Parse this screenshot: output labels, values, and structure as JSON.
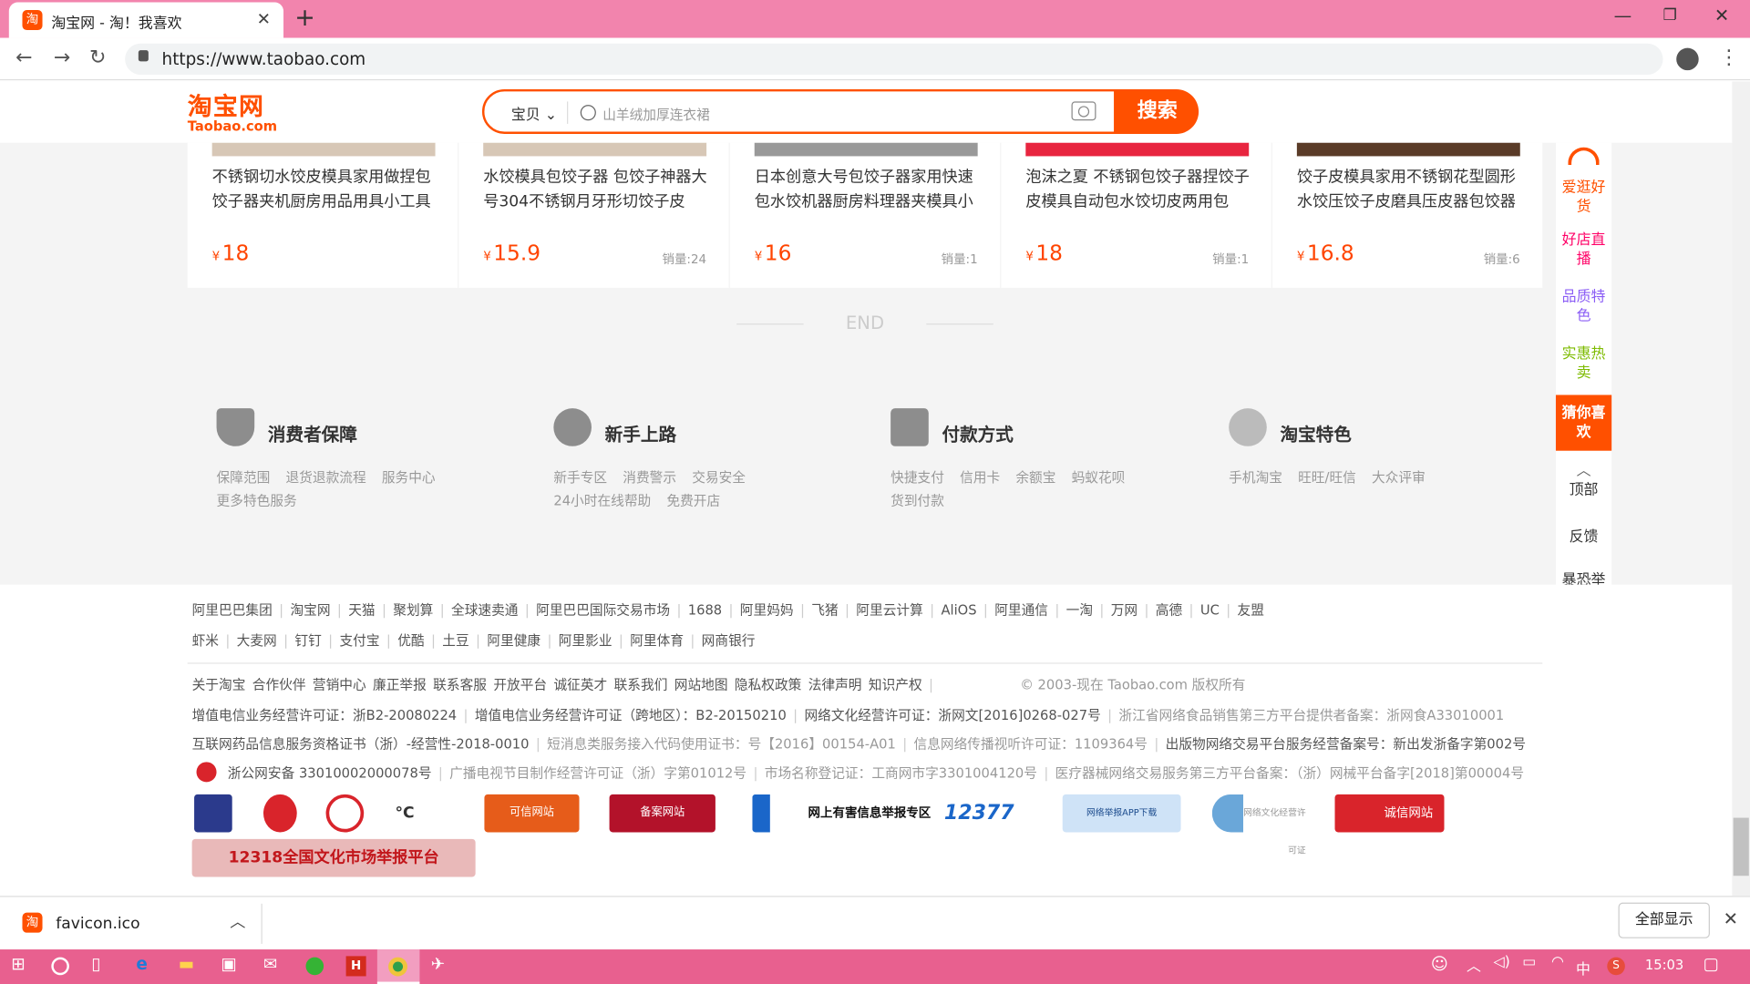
{
  "browser": {
    "tab_title": "淘宝网 - 淘！我喜欢",
    "tab_favicon": "淘",
    "url": "https://www.taobao.com"
  },
  "header": {
    "logo_cn": "淘宝网",
    "logo_en": "Taobao.com",
    "search_category": "宝贝 ⌄",
    "search_placeholder": "山羊绒加厚连衣裙",
    "search_button": "搜索"
  },
  "products": [
    {
      "title": "不锈钢切水饺皮模具家用做捏包饺子器夹机厨房用品用具小工具",
      "price": "18",
      "sales": ""
    },
    {
      "title": "水饺模具包饺子器 包饺子神器大号304不锈钢月牙形切饺子皮",
      "price": "15.9",
      "sales": "销量:24"
    },
    {
      "title": "日本创意大号包饺子器家用快速包水饺机器厨房料理器夹模具小",
      "price": "16",
      "sales": "销量:1"
    },
    {
      "title": "泡沫之夏 不锈钢包饺子器捏饺子皮模具自动包水饺切皮两用包",
      "price": "18",
      "sales": "销量:1"
    },
    {
      "title": "饺子皮模具家用不锈钢花型圆形水饺压饺子皮磨具压皮器包饺器",
      "price": "16.8",
      "sales": "销量:6"
    }
  ],
  "currency": "¥",
  "end_text": "END",
  "services": [
    {
      "title": "消费者保障",
      "links": [
        "保障范围",
        "退货退款流程",
        "服务中心",
        "更多特色服务"
      ]
    },
    {
      "title": "新手上路",
      "links": [
        "新手专区",
        "消费警示",
        "交易安全",
        "24小时在线帮助",
        "免费开店"
      ]
    },
    {
      "title": "付款方式",
      "links": [
        "快捷支付",
        "信用卡",
        "余额宝",
        "蚂蚁花呗",
        "货到付款"
      ]
    },
    {
      "title": "淘宝特色",
      "links": [
        "手机淘宝",
        "旺旺/旺信",
        "大众评审"
      ]
    }
  ],
  "sidebar": {
    "items": [
      {
        "label": "爱逛好货",
        "color": "#ff5000"
      },
      {
        "label": "好店直播",
        "color": "#ff0066"
      },
      {
        "label": "品质特色",
        "color": "#8a5cf5"
      },
      {
        "label": "实惠热卖",
        "color": "#7dbb00"
      }
    ],
    "active": "猜你喜欢",
    "top": "顶部",
    "feedback": "反馈",
    "report": "暴恐举报"
  },
  "footer": {
    "row1": [
      "阿里巴巴集团",
      "淘宝网",
      "天猫",
      "聚划算",
      "全球速卖通",
      "阿里巴巴国际交易市场",
      "1688",
      "阿里妈妈",
      "飞猪",
      "阿里云计算",
      "AliOS",
      "阿里通信",
      "一淘",
      "万网",
      "高德",
      "UC",
      "友盟"
    ],
    "row2": [
      "虾米",
      "大麦网",
      "钉钉",
      "支付宝",
      "优酷",
      "土豆",
      "阿里健康",
      "阿里影业",
      "阿里体育",
      "网商银行"
    ],
    "row3": [
      "关于淘宝",
      "合作伙伴",
      "营销中心",
      "廉正举报",
      "联系客服",
      "开放平台",
      "诚征英才",
      "联系我们",
      "网站地图",
      "隐私权政策",
      "法律声明",
      "知识产权"
    ],
    "copyright": "© 2003-现在 Taobao.com 版权所有",
    "license1": "增值电信业务经营许可证：浙B2-20080224",
    "license2": "增值电信业务经营许可证（跨地区）：B2-20150210",
    "license3": "网络文化经营许可证：浙网文[2016]0268-027号",
    "license4": "浙江省网络食品销售第三方平台提供者备案：浙网食A33010001",
    "license5": "互联网药品信息服务资格证书（浙）-经营性-2018-0010",
    "license6": "短消息类服务接入代码使用证书：号【2016】00154-A01",
    "license7": "信息网络传播视听许可证：1109364号",
    "license8": "出版物网络交易平台服务经营备案号：新出发浙备字第002号",
    "license9": "浙公网安备 33010002000078号",
    "license10": "广播电视节目制作经营许可证（浙）字第01012号",
    "license11": "市场名称登记证：工商网市字3301004120号",
    "license12": "医疗器械网络交易服务第三方平台备案：（浙）网械平台备字[2018]第00004号",
    "badges": [
      "可信网站",
      "备案网站",
      "网上有害信息举报专区",
      "12377",
      "网络举报APP下载",
      "网络文化经营许可证",
      "诚信网站",
      "12318全国文化市场举报平台"
    ]
  },
  "download": {
    "filename": "favicon.ico",
    "show_all": "全部显示"
  },
  "taskbar": {
    "time": "15:03",
    "ime": "中"
  }
}
